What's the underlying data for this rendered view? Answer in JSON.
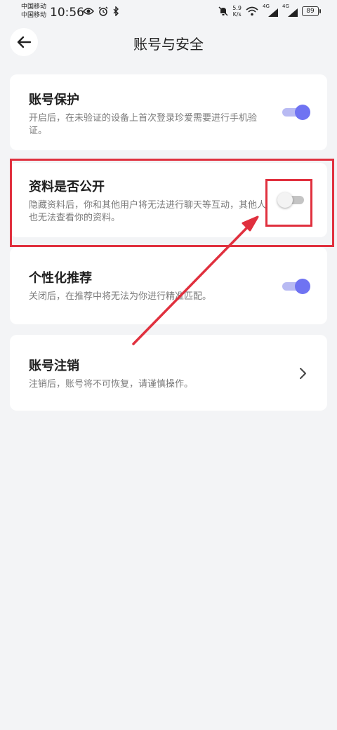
{
  "status_bar": {
    "carrier_1": "中国移动",
    "carrier_2": "中国移动",
    "time": "10:56",
    "net_speed_value": "5.9",
    "net_speed_unit": "K/s",
    "signal_1_label": "4G",
    "signal_2_label": "4G",
    "battery": "89"
  },
  "header": {
    "title": "账号与安全"
  },
  "settings": [
    {
      "title": "账号保护",
      "description": "开启后，在未验证的设备上首次登录珍爱需要进行手机验证。",
      "toggle_on": true
    },
    {
      "title": "资料是否公开",
      "description": "隐藏资料后，你和其他用户将无法进行聊天等互动，其他人也无法查看你的资料。",
      "toggle_on": false
    },
    {
      "title": "个性化推荐",
      "description": "关闭后，在推荐中将无法为你进行精准匹配。",
      "toggle_on": true
    },
    {
      "title": "账号注销",
      "description": "注销后，账号将不可恢复，请谨慎操作。"
    }
  ],
  "colors": {
    "toggle_on": "#6f73f2",
    "annotation": "#e0303e"
  }
}
